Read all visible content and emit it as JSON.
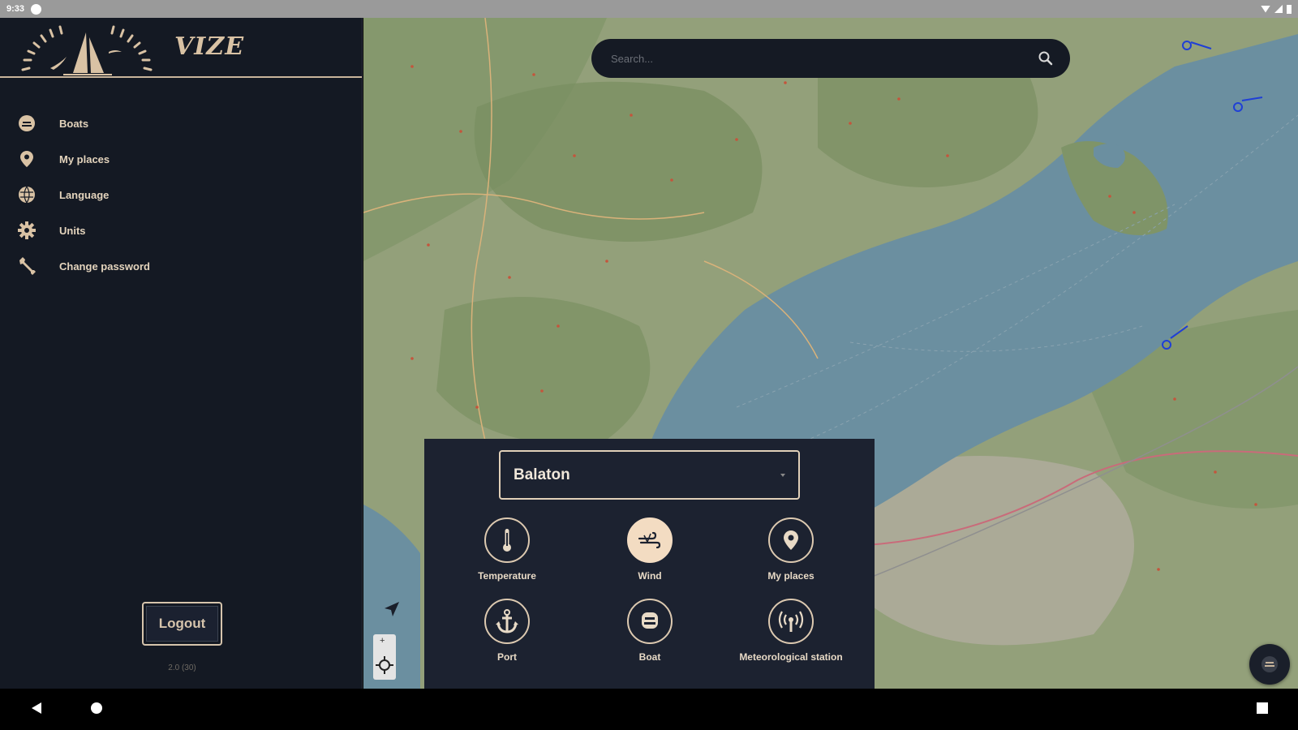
{
  "status_bar": {
    "time": "9:33"
  },
  "app": {
    "name": "VIZE"
  },
  "menu": {
    "items": [
      {
        "label": "Boats",
        "icon": "boat-icon"
      },
      {
        "label": "My places",
        "icon": "location-pin-icon"
      },
      {
        "label": "Language",
        "icon": "globe-icon"
      },
      {
        "label": "Units",
        "icon": "gear-icon"
      },
      {
        "label": "Change password",
        "icon": "wrench-icon"
      }
    ],
    "logout_label": "Logout",
    "version": "2.0 (30)"
  },
  "search": {
    "placeholder": "Search..."
  },
  "panel": {
    "selected_lake": "Balaton",
    "layers": [
      {
        "label": "Temperature",
        "icon": "thermometer-icon",
        "active": false
      },
      {
        "label": "Wind",
        "icon": "wind-icon",
        "active": true
      },
      {
        "label": "My places",
        "icon": "location-pin-icon",
        "active": false
      },
      {
        "label": "Port",
        "icon": "anchor-icon",
        "active": false
      },
      {
        "label": "Boat",
        "icon": "boat-icon",
        "active": false
      },
      {
        "label": "Meteorological station",
        "icon": "antenna-icon",
        "active": false
      }
    ]
  },
  "colors": {
    "sidebar_bg": "#141923",
    "accent": "#d9c2a4",
    "water": "#6b8fa0",
    "land": "#93a07a",
    "wind_marker": "#1f3fd6"
  }
}
